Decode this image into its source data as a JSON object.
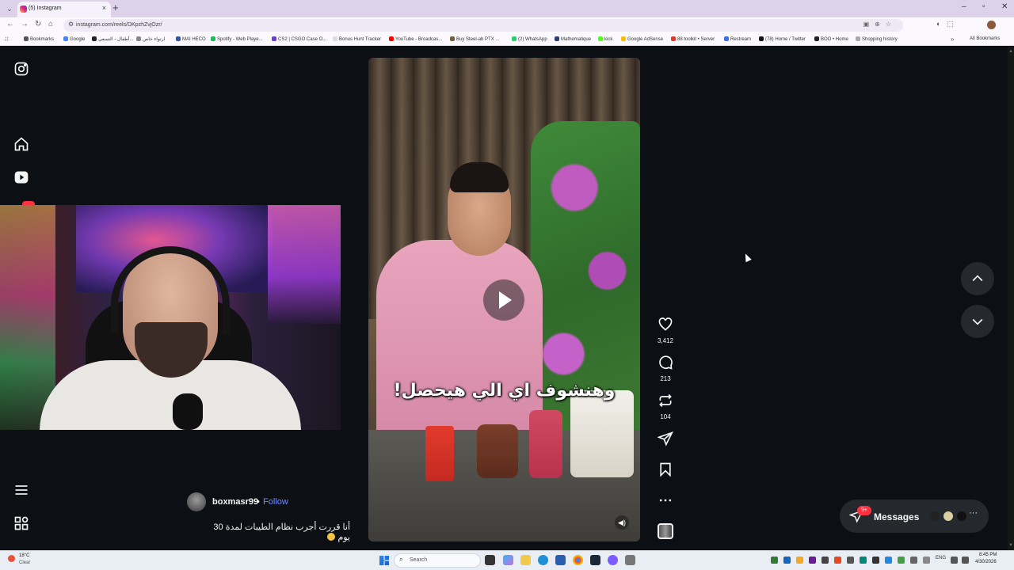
{
  "browser": {
    "tab_title": "(5) Instagram",
    "url": "instagram.com/reels/DKpzhZvjOzr/",
    "bookmarks": [
      {
        "label": "Bookmarks",
        "color": "#555555"
      },
      {
        "label": "Google",
        "color": "#4285f4"
      },
      {
        "label": "أطفال - التسعي...",
        "color": "#222222"
      },
      {
        "label": "ارتواء خاص",
        "color": "#888888"
      },
      {
        "label": "MAI HECO",
        "color": "#3355aa"
      },
      {
        "label": "Spotify - Web Playe...",
        "color": "#1db954"
      },
      {
        "label": "CS2 | CSGO Case O...",
        "color": "#6a3fd0"
      },
      {
        "label": "Bonus Hunt Tracker",
        "color": "#dddddd"
      },
      {
        "label": "YouTube - Broadcas...",
        "color": "#ff0000"
      },
      {
        "label": "Buy Steel-ab PTX ...",
        "color": "#7a5c3a"
      },
      {
        "label": "(2) WhatsApp",
        "color": "#25d366"
      },
      {
        "label": "Mathematique",
        "color": "#2c3e7a"
      },
      {
        "label": "kick",
        "color": "#53fc18"
      },
      {
        "label": "Google AdSense",
        "color": "#fbbc04"
      },
      {
        "label": "88 toolkit • Server",
        "color": "#e23a2c"
      },
      {
        "label": "Restream",
        "color": "#3b6ee8"
      },
      {
        "label": "(78) Home / Twitter",
        "color": "#111111"
      },
      {
        "label": "BOO • Home",
        "color": "#222222"
      },
      {
        "label": "Shopping history",
        "color": "#aaaaaa"
      }
    ],
    "all_bookmarks": "All Bookmarks"
  },
  "reel": {
    "subtitle": "وهنشوف اي الي هيحصل!",
    "username": "boxmasr99",
    "separator": "•",
    "follow_label": "Follow",
    "caption": "أنا قررت أجرب نظام الطيبات لمدة 30 يوم",
    "likes": "3,412",
    "comments": "213",
    "reposts": "104"
  },
  "messages": {
    "label": "Messages",
    "badge": "9+",
    "avatar_colors": [
      "#222222",
      "#d9cfa0",
      "#111111"
    ]
  },
  "taskbar": {
    "temp": "18°C",
    "condition": "Clear",
    "search_placeholder": "Search",
    "lang": "ENG",
    "time": "8:45 PM",
    "date": "4/30/2026"
  },
  "icons": [
    "instagram-logo-icon",
    "home-icon",
    "reels-icon",
    "menu-icon",
    "more-apps-icon",
    "heart-icon",
    "comment-icon",
    "repost-icon",
    "share-icon",
    "bookmark-icon",
    "more-dots-icon",
    "play-icon",
    "mute-icon",
    "arrow-up-icon",
    "arrow-down-icon"
  ]
}
